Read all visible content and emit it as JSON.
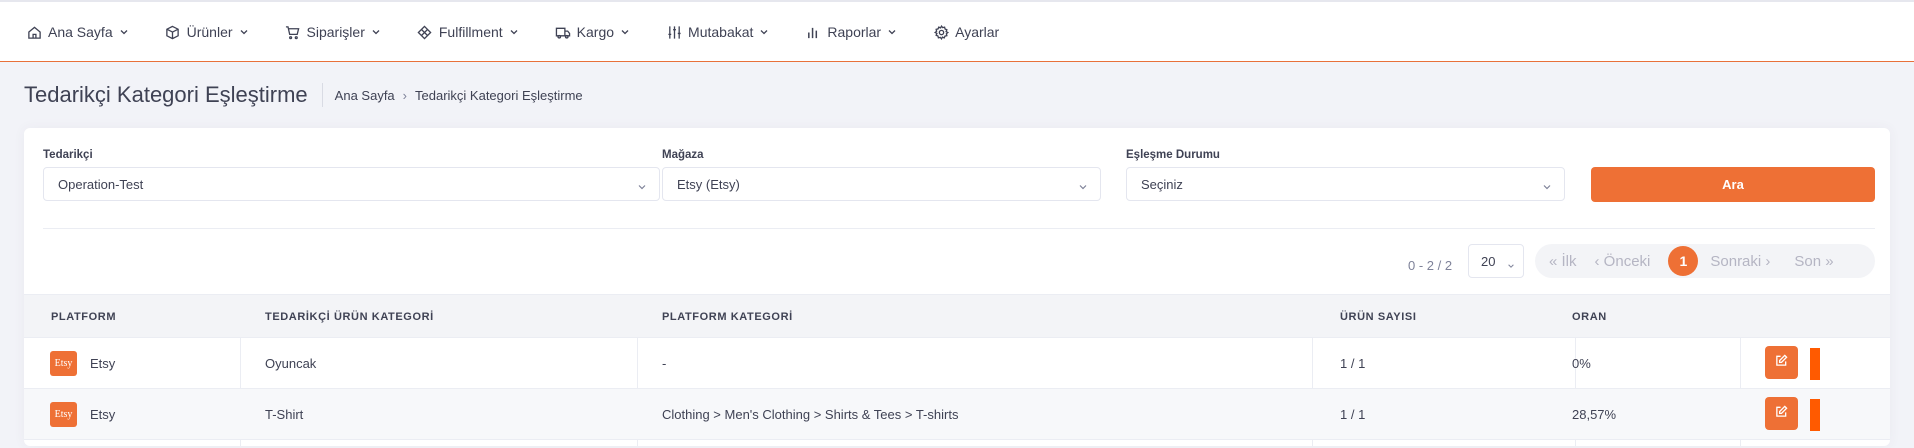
{
  "nav": [
    {
      "label": "Ana Sayfa",
      "icon": "home-icon",
      "dropdown": true
    },
    {
      "label": "Ürünler",
      "icon": "box-icon",
      "dropdown": true
    },
    {
      "label": "Siparişler",
      "icon": "cart-icon",
      "dropdown": true
    },
    {
      "label": "Fulfillment",
      "icon": "package-icon",
      "dropdown": true
    },
    {
      "label": "Kargo",
      "icon": "truck-icon",
      "dropdown": true
    },
    {
      "label": "Mutabakat",
      "icon": "sliders-icon",
      "dropdown": true
    },
    {
      "label": "Raporlar",
      "icon": "bar-chart-icon",
      "dropdown": true
    },
    {
      "label": "Ayarlar",
      "icon": "gear-icon",
      "dropdown": false
    }
  ],
  "subheader": {
    "title": "Tedarikçi Kategori Eşleştirme",
    "breadcrumb": [
      "Ana Sayfa",
      "Tedarikçi Kategori Eşleştirme"
    ]
  },
  "filters": {
    "supplier": {
      "label": "Tedarikçi",
      "value": "Operation-Test"
    },
    "store": {
      "label": "Mağaza",
      "value": "Etsy (Etsy)"
    },
    "match_status": {
      "label": "Eşleşme Durumu",
      "value": "Seçiniz"
    },
    "search_label": "Ara"
  },
  "pagination": {
    "range": "0 - 2 / 2",
    "page_size": "20",
    "first": "« İlk",
    "prev": "‹ Önceki",
    "current": "1",
    "next": "Sonraki ›",
    "last": "Son »"
  },
  "table": {
    "headers": [
      "PLATFORM",
      "TEDARİKÇİ ÜRÜN KATEGORİ",
      "PLATFORM KATEGORİ",
      "ÜRÜN SAYISI",
      "ORAN"
    ],
    "rows": [
      {
        "badge": "Etsy",
        "platform": "Etsy",
        "supplier_category": "Oyuncak",
        "platform_category": "-",
        "product_count": "1 / 1",
        "ratio": "0%"
      },
      {
        "badge": "Etsy",
        "platform": "Etsy",
        "supplier_category": "T-Shirt",
        "platform_category": "Clothing > Men's Clothing > Shirts & Tees > T-shirts",
        "product_count": "1 / 1",
        "ratio": "28,57%"
      }
    ]
  },
  "colors": {
    "accent": "#ee7035",
    "bar": "#ff5a00",
    "background": "#f2f3f8"
  }
}
